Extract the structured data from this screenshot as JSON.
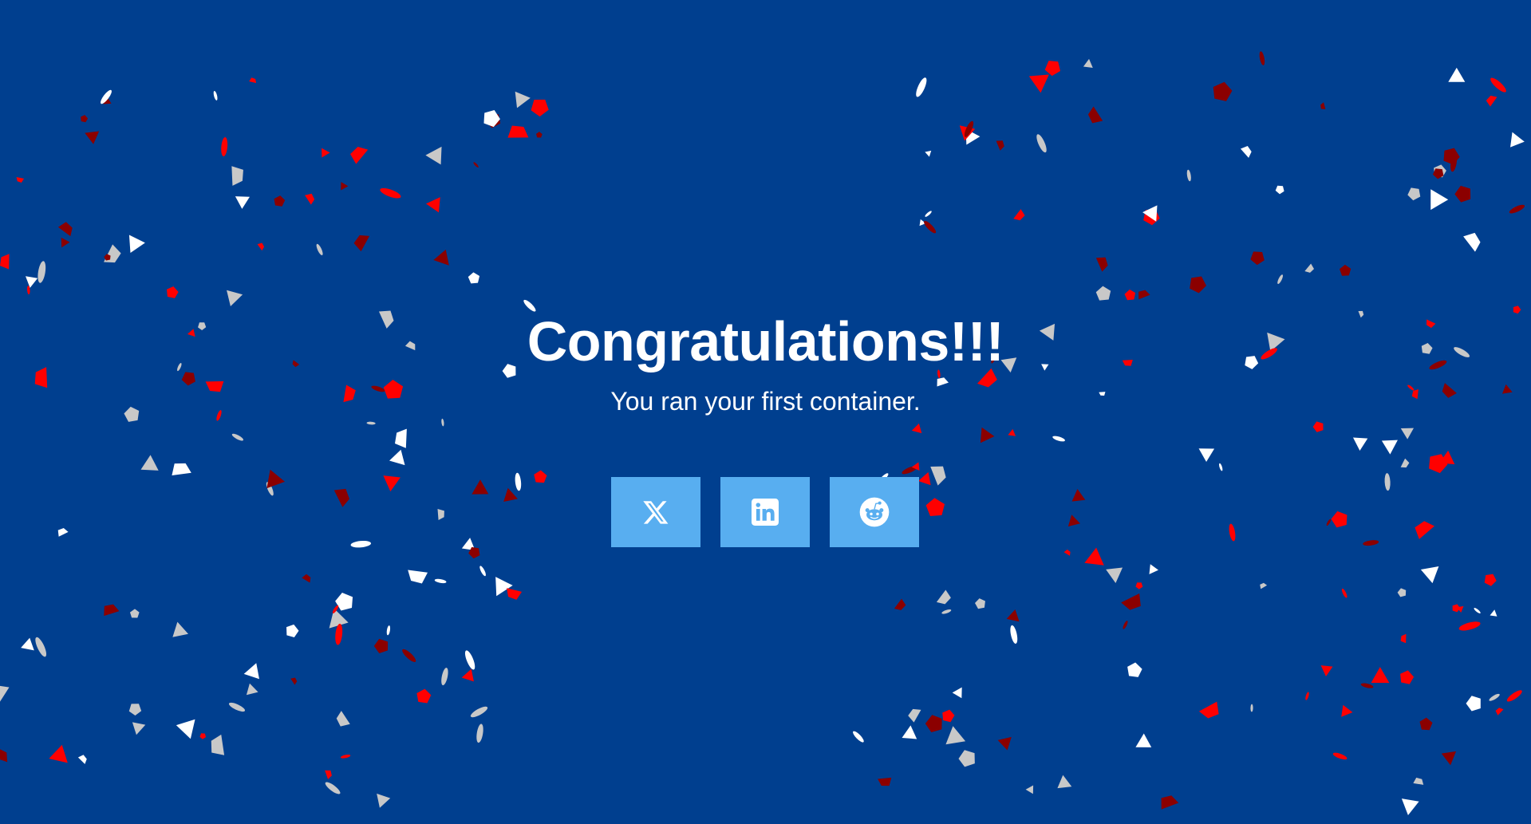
{
  "page": {
    "background_color": "#003f8f",
    "title": "Congratulations!!!",
    "subtitle": "You ran your first container."
  },
  "share_buttons": [
    {
      "name": "x-share-button",
      "icon": "x-logo-icon"
    },
    {
      "name": "linkedin-share-button",
      "icon": "linkedin-logo-icon"
    },
    {
      "name": "reddit-share-button",
      "icon": "reddit-logo-icon"
    }
  ],
  "colors": {
    "button": "#58aef0",
    "text": "#ffffff",
    "confetti": [
      "#ff0000",
      "#8b0000",
      "#ffffff",
      "#c8c8c8"
    ]
  }
}
